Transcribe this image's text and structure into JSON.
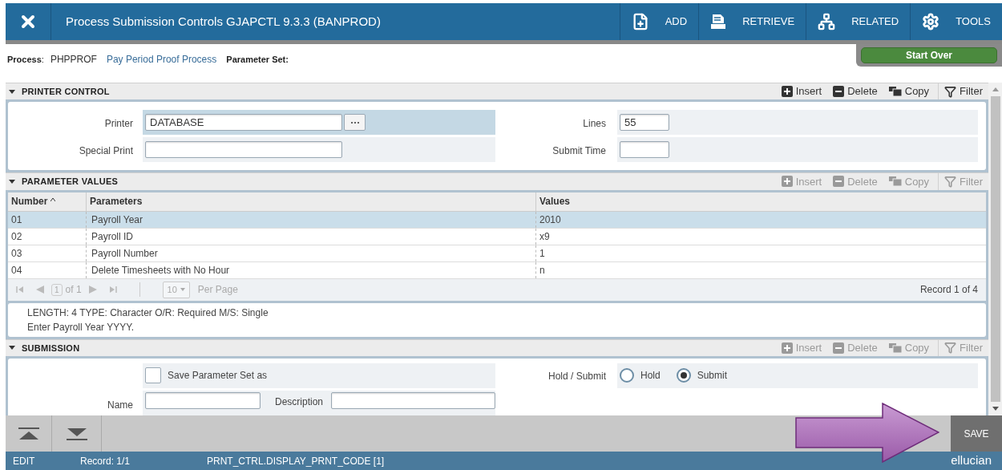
{
  "header": {
    "title": "Process Submission Controls GJAPCTL 9.3.3 (BANPROD)",
    "actions": [
      {
        "label": "ADD",
        "kind": "add"
      },
      {
        "label": "RETRIEVE",
        "kind": "retrieve"
      },
      {
        "label": "RELATED",
        "kind": "related"
      },
      {
        "label": "TOOLS",
        "kind": "tools"
      }
    ]
  },
  "process": {
    "label": "**Process**:",
    "code": "PHPPROF",
    "name": "Pay Period Proof Process",
    "parameter_set_label": "Parameter Set:"
  },
  "start_over": "Start Over",
  "printer_control": {
    "title": "PRINTER CONTROL",
    "tools": [
      {
        "label": "Insert",
        "kind": "insert",
        "disabled": false
      },
      {
        "label": "Delete",
        "kind": "delete",
        "disabled": false
      },
      {
        "label": "Copy",
        "kind": "copy",
        "disabled": false
      },
      {
        "label": "Filter",
        "kind": "filter",
        "disabled": false
      }
    ],
    "rows": [
      {
        "focused": true,
        "left": {
          "label": "Printer",
          "value": "DATABASE",
          "lookup": true
        },
        "right": {
          "label": "Lines",
          "value": "55"
        }
      },
      {
        "focused": false,
        "left": {
          "label": "Special Print",
          "lookup": false
        },
        "right": {
          "label": "Submit Time"
        }
      }
    ]
  },
  "parameter_values": {
    "title": "PARAMETER VALUES",
    "tools": [
      {
        "label": "Insert",
        "kind": "insert",
        "disabled": true
      },
      {
        "label": "Delete",
        "kind": "delete",
        "disabled": true
      },
      {
        "label": "Copy",
        "kind": "copy",
        "disabled": true
      },
      {
        "label": "Filter",
        "kind": "filter",
        "disabled": true
      }
    ],
    "columns": [
      {
        "label": "Number",
        "sorted": true
      },
      {
        "label": "Parameters",
        "sorted": false
      },
      {
        "label": "Values",
        "sorted": false
      }
    ],
    "rows": [
      {
        "number": "01",
        "parameter": "Payroll Year",
        "value": "2010",
        "selected": true
      },
      {
        "number": "02",
        "parameter": "Payroll ID",
        "value": "x9",
        "selected": false
      },
      {
        "number": "03",
        "parameter": "Payroll Number",
        "value": "1",
        "selected": false
      },
      {
        "number": "04",
        "parameter": "Delete Timesheets with No Hour",
        "value": "n",
        "selected": false
      }
    ],
    "pager": {
      "page": "1",
      "of": "of 1",
      "per_page": "10",
      "per_page_label": "Per Page",
      "record": "Record 1 of 4"
    },
    "help": [
      "LENGTH: 4 TYPE: Character O/R: Required M/S: Single",
      "Enter Payroll Year YYYY."
    ]
  },
  "submission": {
    "title": "SUBMISSION",
    "tools": [
      {
        "label": "Insert",
        "kind": "insert",
        "disabled": true
      },
      {
        "label": "Delete",
        "kind": "delete",
        "disabled": true
      },
      {
        "label": "Copy",
        "kind": "copy",
        "disabled": true
      },
      {
        "label": "Filter",
        "kind": "filter",
        "disabled": true
      }
    ],
    "save_set": {
      "label": "Save Parameter Set as",
      "checked": false
    },
    "hold_submit": {
      "label": "Hold / Submit",
      "options": [
        {
          "label": "Hold",
          "selected": false
        },
        {
          "label": "Submit",
          "selected": true
        }
      ]
    },
    "name_label": "Name",
    "description_label": "Description"
  },
  "save": "SAVE",
  "status": {
    "mode": "EDIT",
    "record": "Record: 1/1",
    "field": "PRNT_CTRL.DISPLAY_PRNT_CODE [1]",
    "brand": "ellucian"
  }
}
